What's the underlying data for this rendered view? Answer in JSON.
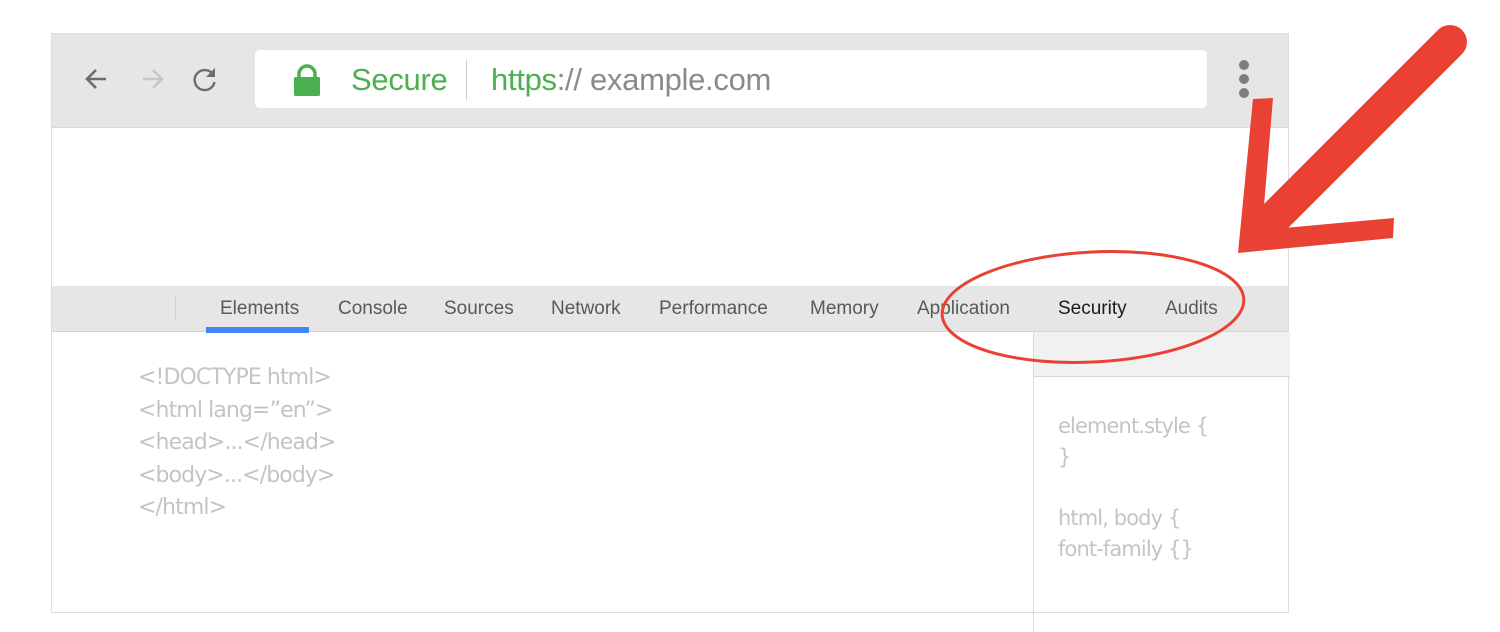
{
  "browser": {
    "nav": {
      "back_icon": "arrow-left-icon",
      "forward_icon": "arrow-right-icon",
      "reload_icon": "reload-icon"
    },
    "omnibox": {
      "lock_icon": "lock-icon",
      "security_label": "Secure",
      "url_scheme": "https",
      "url_separator": "://",
      "url_host": " example.com"
    },
    "menu_icon": "more-vert-icon"
  },
  "devtools": {
    "tabs": [
      {
        "label": "Elements",
        "active": true
      },
      {
        "label": "Console"
      },
      {
        "label": "Sources"
      },
      {
        "label": "Network"
      },
      {
        "label": "Performance"
      },
      {
        "label": "Memory"
      },
      {
        "label": "Application"
      },
      {
        "label": "Security",
        "highlighted": true
      },
      {
        "label": "Audits"
      }
    ],
    "elements_code": [
      "<!DOCTYPE html>",
      "<html lang=”en”>",
      "<head>...</head>",
      "<body>...</body>",
      "</html>"
    ],
    "styles": {
      "rule1_selector": "element.style  {",
      "rule1_close": "}",
      "rule2_selector": "html, body   {",
      "rule2_body": "font-family {}"
    }
  },
  "annotation": {
    "color": "#e94235",
    "arrow_icon": "red-arrow-pointing-down-left",
    "circle_target": "Security"
  },
  "colors": {
    "secure_green": "#4caf50",
    "active_tab_blue": "#4285f4",
    "toolbar_gray": "#e6e6e6"
  }
}
